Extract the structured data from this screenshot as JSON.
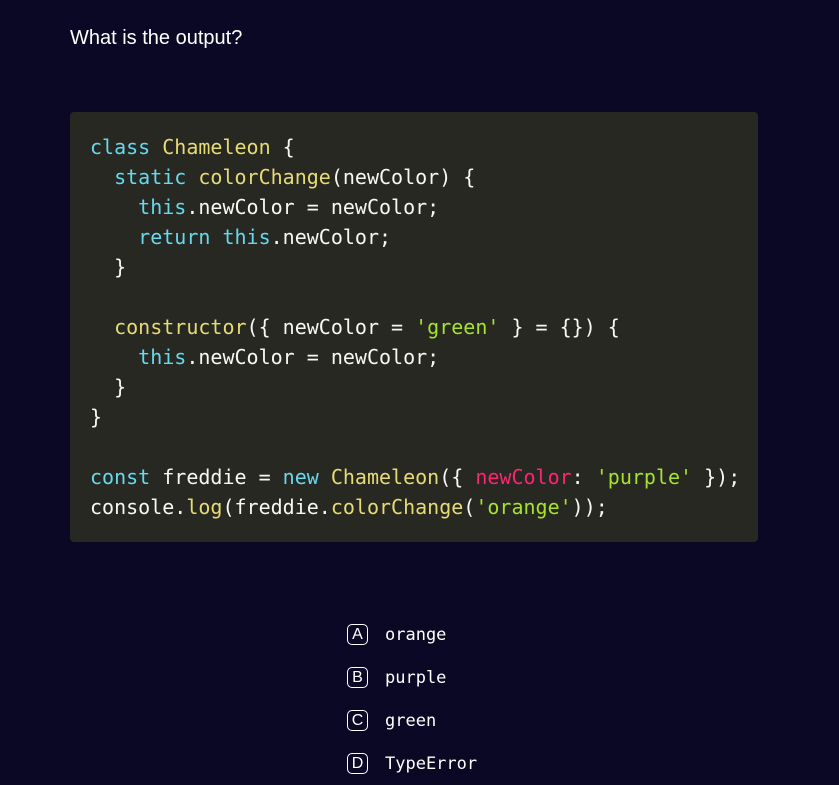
{
  "question": "What is the output?",
  "code_lines": [
    [
      [
        "kw",
        "class"
      ],
      [
        "",
        " "
      ],
      [
        "cls",
        "Chameleon"
      ],
      [
        "",
        " {"
      ]
    ],
    [
      [
        "",
        "  "
      ],
      [
        "kw",
        "static"
      ],
      [
        "",
        " "
      ],
      [
        "fn",
        "colorChange"
      ],
      [
        "",
        "(newColor) {"
      ]
    ],
    [
      [
        "",
        "    "
      ],
      [
        "kw",
        "this"
      ],
      [
        "",
        ".newColor = newColor;"
      ]
    ],
    [
      [
        "",
        "    "
      ],
      [
        "kw",
        "return"
      ],
      [
        "",
        " "
      ],
      [
        "kw",
        "this"
      ],
      [
        "",
        ".newColor;"
      ]
    ],
    [
      [
        "",
        "  }"
      ]
    ],
    [],
    [
      [
        "",
        "  "
      ],
      [
        "fn",
        "constructor"
      ],
      [
        "",
        "({ newColor = "
      ],
      [
        "str",
        "'green'"
      ],
      [
        "",
        " } = {}) {"
      ]
    ],
    [
      [
        "",
        "    "
      ],
      [
        "kw",
        "this"
      ],
      [
        "",
        ".newColor = newColor;"
      ]
    ],
    [
      [
        "",
        "  }"
      ]
    ],
    [
      [
        "",
        "}"
      ]
    ],
    [],
    [
      [
        "kw",
        "const"
      ],
      [
        "",
        " freddie = "
      ],
      [
        "kw",
        "new"
      ],
      [
        "",
        " "
      ],
      [
        "cls",
        "Chameleon"
      ],
      [
        "",
        "({ "
      ],
      [
        "prop",
        "newColor"
      ],
      [
        "",
        ": "
      ],
      [
        "str",
        "'purple'"
      ],
      [
        "",
        " });"
      ]
    ],
    [
      [
        "",
        "console."
      ],
      [
        "fn",
        "log"
      ],
      [
        "",
        "(freddie."
      ],
      [
        "fn",
        "colorChange"
      ],
      [
        "",
        "("
      ],
      [
        "str",
        "'orange'"
      ],
      [
        "",
        "));"
      ]
    ]
  ],
  "options": [
    {
      "letter": "A",
      "text": "orange"
    },
    {
      "letter": "B",
      "text": "purple"
    },
    {
      "letter": "C",
      "text": "green"
    },
    {
      "letter": "D",
      "text": "TypeError"
    }
  ]
}
